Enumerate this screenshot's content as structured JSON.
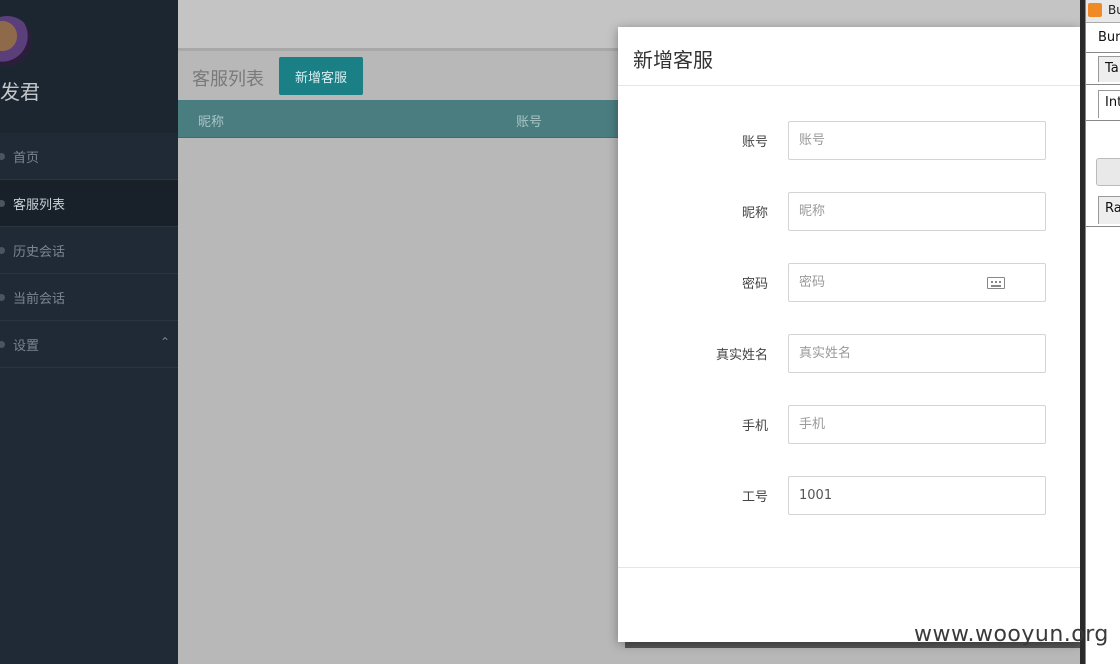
{
  "sidebar": {
    "username": "发君",
    "items": [
      {
        "label": "首页"
      },
      {
        "label": "客服列表"
      },
      {
        "label": "历史会话"
      },
      {
        "label": "当前会话"
      },
      {
        "label": "设置"
      }
    ]
  },
  "main": {
    "title": "客服列表",
    "add_button": "新增客服",
    "columns": [
      "昵称",
      "账号"
    ]
  },
  "modal": {
    "title": "新增客服",
    "fields": [
      {
        "label": "账号",
        "placeholder": "账号",
        "value": ""
      },
      {
        "label": "昵称",
        "placeholder": "昵称",
        "value": ""
      },
      {
        "label": "密码",
        "placeholder": "密码",
        "value": ""
      },
      {
        "label": "真实姓名",
        "placeholder": "真实姓名",
        "value": ""
      },
      {
        "label": "手机",
        "placeholder": "手机",
        "value": ""
      },
      {
        "label": "工号",
        "placeholder": "",
        "value": "1001"
      }
    ]
  },
  "side_app": {
    "title": "Bu",
    "menu": "Burp",
    "tab1": "Ta",
    "tab2": "Int",
    "tab3": "Ra"
  },
  "watermark": "www.wooyun.org",
  "colors": {
    "sidebar": "#1f2a36",
    "accent": "#1b7f86",
    "table_header": "#4a7d80"
  }
}
